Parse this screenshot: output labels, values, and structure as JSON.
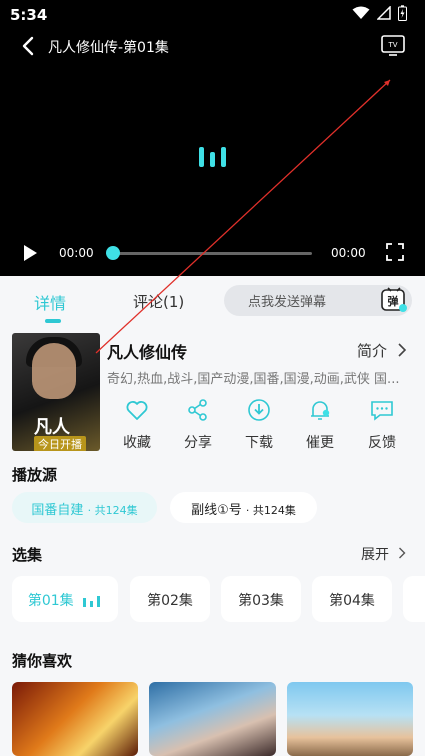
{
  "status": {
    "time": "5:34"
  },
  "player": {
    "title": "凡人修仙传-第01集",
    "current_time": "00:00",
    "duration": "00:00",
    "progress": 0
  },
  "tabs": [
    {
      "label": "详情"
    },
    {
      "label": "评论(1)"
    }
  ],
  "danmu": {
    "placeholder": "点我发送弹幕",
    "button_label": "弹"
  },
  "show": {
    "title": "凡人修仙传",
    "intro_label": "简介",
    "tags": "奇幻,热血,战斗,国产动漫,国番,国漫,动画,武侠 国...",
    "poster_title": "凡人",
    "poster_badge": "今日开播"
  },
  "actions": [
    {
      "label": "收藏",
      "icon": "heart-icon"
    },
    {
      "label": "分享",
      "icon": "share-icon"
    },
    {
      "label": "下载",
      "icon": "download-icon"
    },
    {
      "label": "催更",
      "icon": "bell-icon"
    },
    {
      "label": "反馈",
      "icon": "feedback-icon"
    }
  ],
  "sources": {
    "title": "播放源",
    "items": [
      {
        "label": "国番自建",
        "count": "· 共124集",
        "active": true
      },
      {
        "label": "副线①号",
        "count": "· 共124集",
        "active": false
      }
    ]
  },
  "episodes": {
    "title": "选集",
    "expand_label": "展开",
    "items": [
      "第01集",
      "第02集",
      "第03集",
      "第04集"
    ]
  },
  "recommend": {
    "title": "猜你喜欢"
  },
  "colors": {
    "accent": "#2fc8d3",
    "player_bg": "#000000",
    "page_bg": "#f6f7f9"
  }
}
